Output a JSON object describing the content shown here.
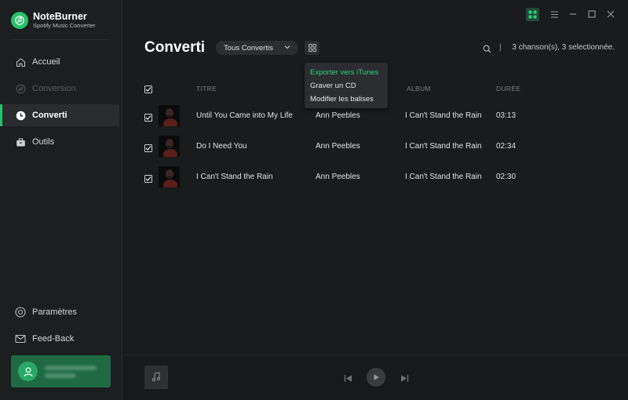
{
  "app": {
    "name": "NoteBurner",
    "subtitle": "Spotify Music Converter"
  },
  "sidebar": {
    "items": [
      {
        "label": "Accueil",
        "icon": "home-icon",
        "state": "normal"
      },
      {
        "label": "Conversion",
        "icon": "conversion-icon",
        "state": "disabled"
      },
      {
        "label": "Converti",
        "icon": "clock-icon",
        "state": "active"
      },
      {
        "label": "Outils",
        "icon": "toolbox-icon",
        "state": "normal"
      }
    ],
    "bottom_items": [
      {
        "label": "Paramètres",
        "icon": "settings-icon"
      },
      {
        "label": "Feed-Back",
        "icon": "mail-icon"
      }
    ]
  },
  "main": {
    "title": "Converti",
    "filter": {
      "selected": "Tous Convertis"
    },
    "status": "3 chanson(s), 3 selectionnée.",
    "divider": "|",
    "menu": {
      "items": [
        "Exporter vers iTunes",
        "Graver un CD",
        "Modifier les balises"
      ],
      "highlighted": "Exporter vers iTunes"
    },
    "table": {
      "headers": {
        "title": "TITRE",
        "album": "ALBUM",
        "duration": "DURÉE"
      },
      "rows": [
        {
          "title": "Until You Came into My Life",
          "artist": "Ann Peebles",
          "album": "I Can't Stand the Rain",
          "duration": "03:13"
        },
        {
          "title": "Do I Need You",
          "artist": "Ann Peebles",
          "album": "I Can't Stand the Rain",
          "duration": "02:34"
        },
        {
          "title": "I Can't Stand the Rain",
          "artist": "Ann Peebles",
          "album": "I Can't Stand the Rain",
          "duration": "02:30"
        }
      ]
    }
  },
  "colors": {
    "accent": "#27c06b",
    "bg": "#1a1b1d",
    "sidebar": "#1d1e20",
    "user_card": "#1f6a43"
  }
}
